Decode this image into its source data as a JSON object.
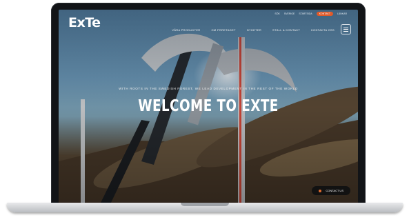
{
  "brand": {
    "logo": "ExTe"
  },
  "utility": [
    "Sök",
    "Sverige",
    "Startsida",
    "Kontakt",
    "Länkar"
  ],
  "nav": {
    "items": [
      "Våra produkter",
      "Om företaget",
      "Nyheter",
      "Ställ & kontakt",
      "Kontakta oss"
    ]
  },
  "hero": {
    "tagline": "With roots in the Swedish forest, we lead development in the rest of the world",
    "headline": "WELCOME TO EXTE"
  },
  "contact": {
    "label": "Contact us"
  },
  "colors": {
    "accent": "#e05a2a",
    "bg_dark": "#121417"
  }
}
